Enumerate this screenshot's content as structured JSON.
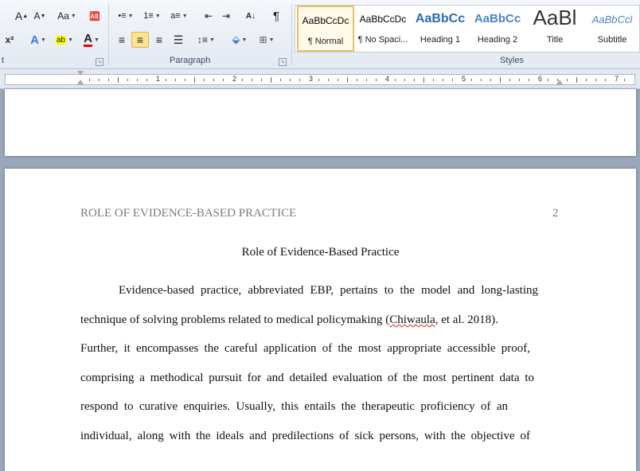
{
  "ribbon": {
    "groups": {
      "paragraph": "Paragraph",
      "styles": "Styles",
      "font_fragment": "t"
    },
    "font_buttons": {
      "grow": "A",
      "shrink": "A",
      "change_case": "Aa",
      "superscript": "x²",
      "highlight": "ab"
    },
    "paragraph_buttons": {
      "pilcrow": "¶"
    },
    "styles": [
      {
        "preview": "AaBbCcDc",
        "name": "¶ Normal",
        "selected": true
      },
      {
        "preview": "AaBbCcDc",
        "name": "¶ No Spaci..."
      },
      {
        "preview": "AaBbCc",
        "name": "Heading 1"
      },
      {
        "preview": "AaBbCc",
        "name": "Heading 2"
      },
      {
        "preview": "AaBl",
        "name": "Title"
      },
      {
        "preview": "AaBbCcl",
        "name": "Subtitle"
      }
    ]
  },
  "ruler": {
    "numbers": [
      "1",
      "2",
      "3",
      "4",
      "5",
      "6",
      "7"
    ]
  },
  "document": {
    "running_head": "ROLE OF EVIDENCE-BASED PRACTICE",
    "page_number": "2",
    "title": "Role of Evidence-Based Practice",
    "lines": [
      "Evidence-based practice, abbreviated EBP, pertains to the model and long-lasting",
      "technique of solving problems related to medical policymaking",
      "Further, it encompasses the careful application of the most appropriate accessible proof,",
      "comprising a methodical pursuit for and detailed evaluation of the most pertinent data to",
      "respond to curative enquiries. Usually, this entails the therapeutic proficiency of an",
      "individual, along with the ideals and predilections of sick persons, with the objective of"
    ],
    "citation_author": "Chiwaula",
    "citation_rest": ", et al. 2018).",
    "citation_open": "("
  },
  "colors": {
    "accent_selected": "#fde58f",
    "heading_blue": "#2b6cb3",
    "header_gray": "#7b7b7b"
  }
}
